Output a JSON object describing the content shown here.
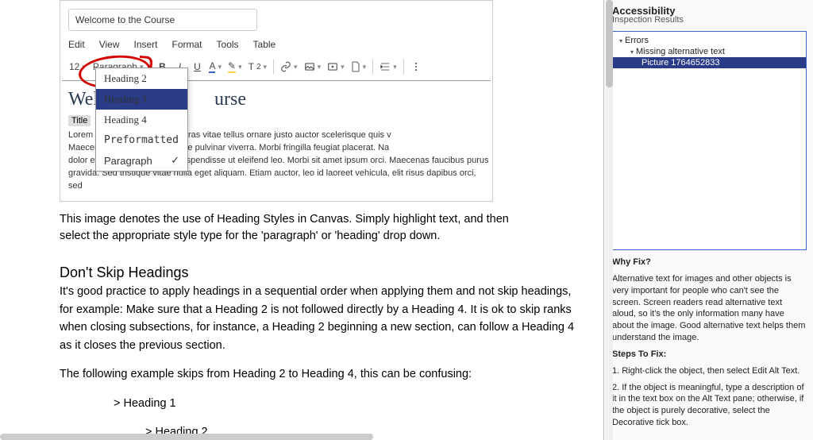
{
  "editor": {
    "title_input": "Welcome to the Course",
    "menus": [
      "Edit",
      "View",
      "Insert",
      "Format",
      "Tools",
      "Table"
    ],
    "font_size": "12",
    "style_selector": "Paragraph",
    "heading_preview": "Heading 2",
    "doc_heading_partial_left": "Welc",
    "doc_heading_partial_right": "urse",
    "title_chip": "Title",
    "dropdown": {
      "h2": "Heading 2",
      "h3": "Heading 3",
      "h4": "Heading 4",
      "pre": "Preformatted",
      "para": "Paragraph",
      "check": "✓"
    },
    "lorem_l1": "Lorem ip                                              tetur adipiscing elit. Cras vitae tellus ornare justo auctor scelerisque quis v",
    "lorem_l2": "Maecena                                               volutpat mauris a ante pulvinar viverra. Morbi fringilla feugiat placerat. Na",
    "lorem_l3": "dolor et faucibus imperdiet. Suspendisse ut eleifend leo. Morbi sit amet ipsum orci. Maecenas faucibus purus",
    "lorem_l4": "gravida. Sed tristique vitae nulla eget aliquam. Etiam auctor, leo id laoreet vehicula, elit risus dapibus orci, sed"
  },
  "caption": "This image denotes the use of Heading Styles in Canvas. Simply highlight text, and then select the appropriate style type for the 'paragraph' or 'heading' drop down.",
  "section": {
    "heading": "Don't Skip Headings",
    "p1": "It's good practice to apply headings in a sequential order when applying them and not skip headings, for example: Make sure that a Heading 2 is not followed directly by a Heading 4. It is ok to skip ranks when closing subsections, for instance, a Heading 2 beginning a new section, can follow a Heading 4 as it closes the previous section.",
    "p2": "The following example skips from Heading 2 to Heading 4, this can be confusing:",
    "ex1": "> Heading 1",
    "ex2": "> Heading 2"
  },
  "panel": {
    "title": "Accessibility",
    "subtitle": "Inspection Results",
    "tree": {
      "errors": "Errors",
      "missing": "Missing alternative text",
      "picture": "Picture 1764652833"
    },
    "why_head": "Why Fix?",
    "why_body": "Alternative text for images and other objects is very important for people who can't see the screen. Screen readers read alternative text aloud, so it's the only information many have about the image. Good alternative text helps them understand the image.",
    "steps_head": "Steps To Fix:",
    "step1": "1. Right-click the object, then select Edit Alt Text.",
    "step2": "2. If the object is meaningful, type a description of it in the text box on the Alt Text pane; otherwise, if the object is purely decorative, select the Decorative tick box."
  }
}
